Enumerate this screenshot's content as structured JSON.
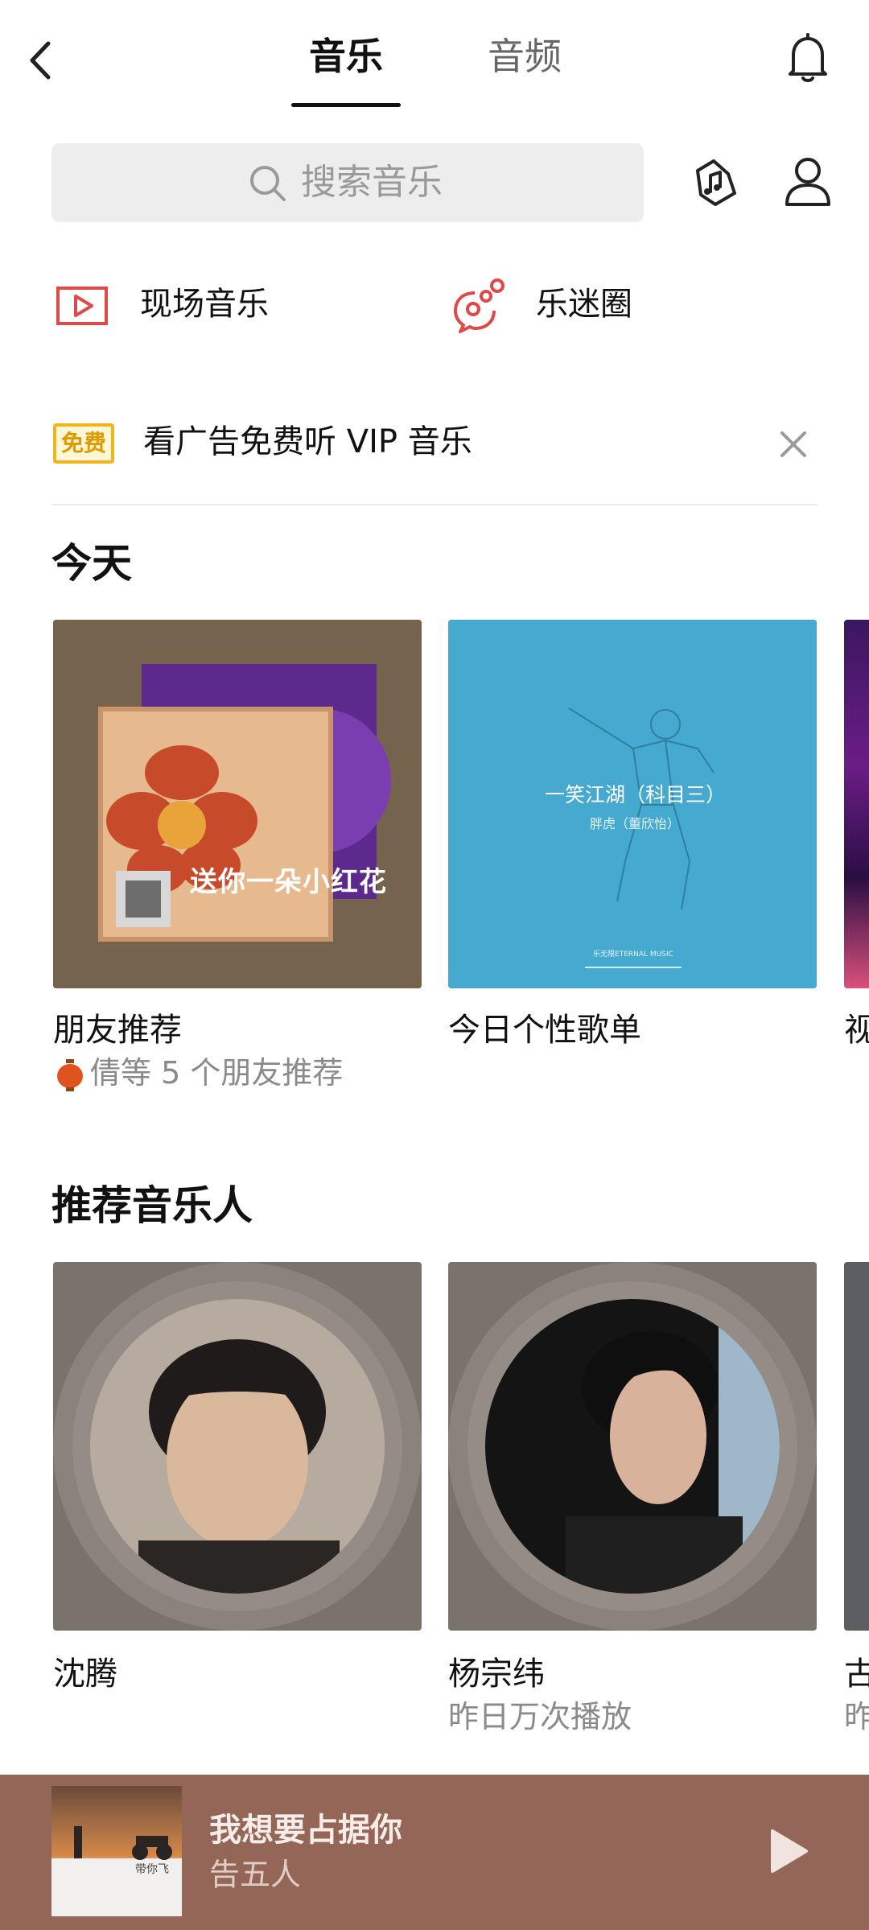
{
  "header": {
    "tabs": [
      {
        "label": "音乐",
        "active": true
      },
      {
        "label": "音频",
        "active": false
      }
    ],
    "icons": {
      "back": "chevron-left-icon",
      "notifications": "bell-icon"
    }
  },
  "search": {
    "placeholder": "搜索音乐",
    "icons": {
      "search": "search-icon",
      "recognize": "music-recognize-icon",
      "profile": "user-icon"
    }
  },
  "quick_entries": [
    {
      "label": "现场音乐",
      "icon": "live-video-icon",
      "color": "#e0494a"
    },
    {
      "label": "乐迷圈",
      "icon": "fan-circle-icon",
      "color": "#e0494a"
    }
  ],
  "ad_banner": {
    "badge": "免费",
    "text": "看广告免费听 VIP 音乐",
    "badge_color": "#f0b51d"
  },
  "today": {
    "title": "今天",
    "cards": [
      {
        "label": "朋友推荐",
        "sub": "倩等 5 个朋友推荐",
        "cover_text": "送你一朵小红花"
      },
      {
        "label": "今日个性歌单",
        "cover_title": "一笑江湖（科目三）",
        "cover_sub": "胖虎（董欣怡）",
        "cover_footer": "乐无限ETERNAL MUSIC"
      },
      {
        "label": "视"
      }
    ]
  },
  "artists": {
    "title": "推荐音乐人",
    "items": [
      {
        "name": "沈腾",
        "sub": ""
      },
      {
        "name": "杨宗纬",
        "sub": "昨日万次播放"
      },
      {
        "name": "古",
        "sub": "昨"
      }
    ]
  },
  "player": {
    "title": "我想要占据你",
    "artist": "告五人",
    "cover_caption": "带你飞",
    "accent": "#946657"
  }
}
